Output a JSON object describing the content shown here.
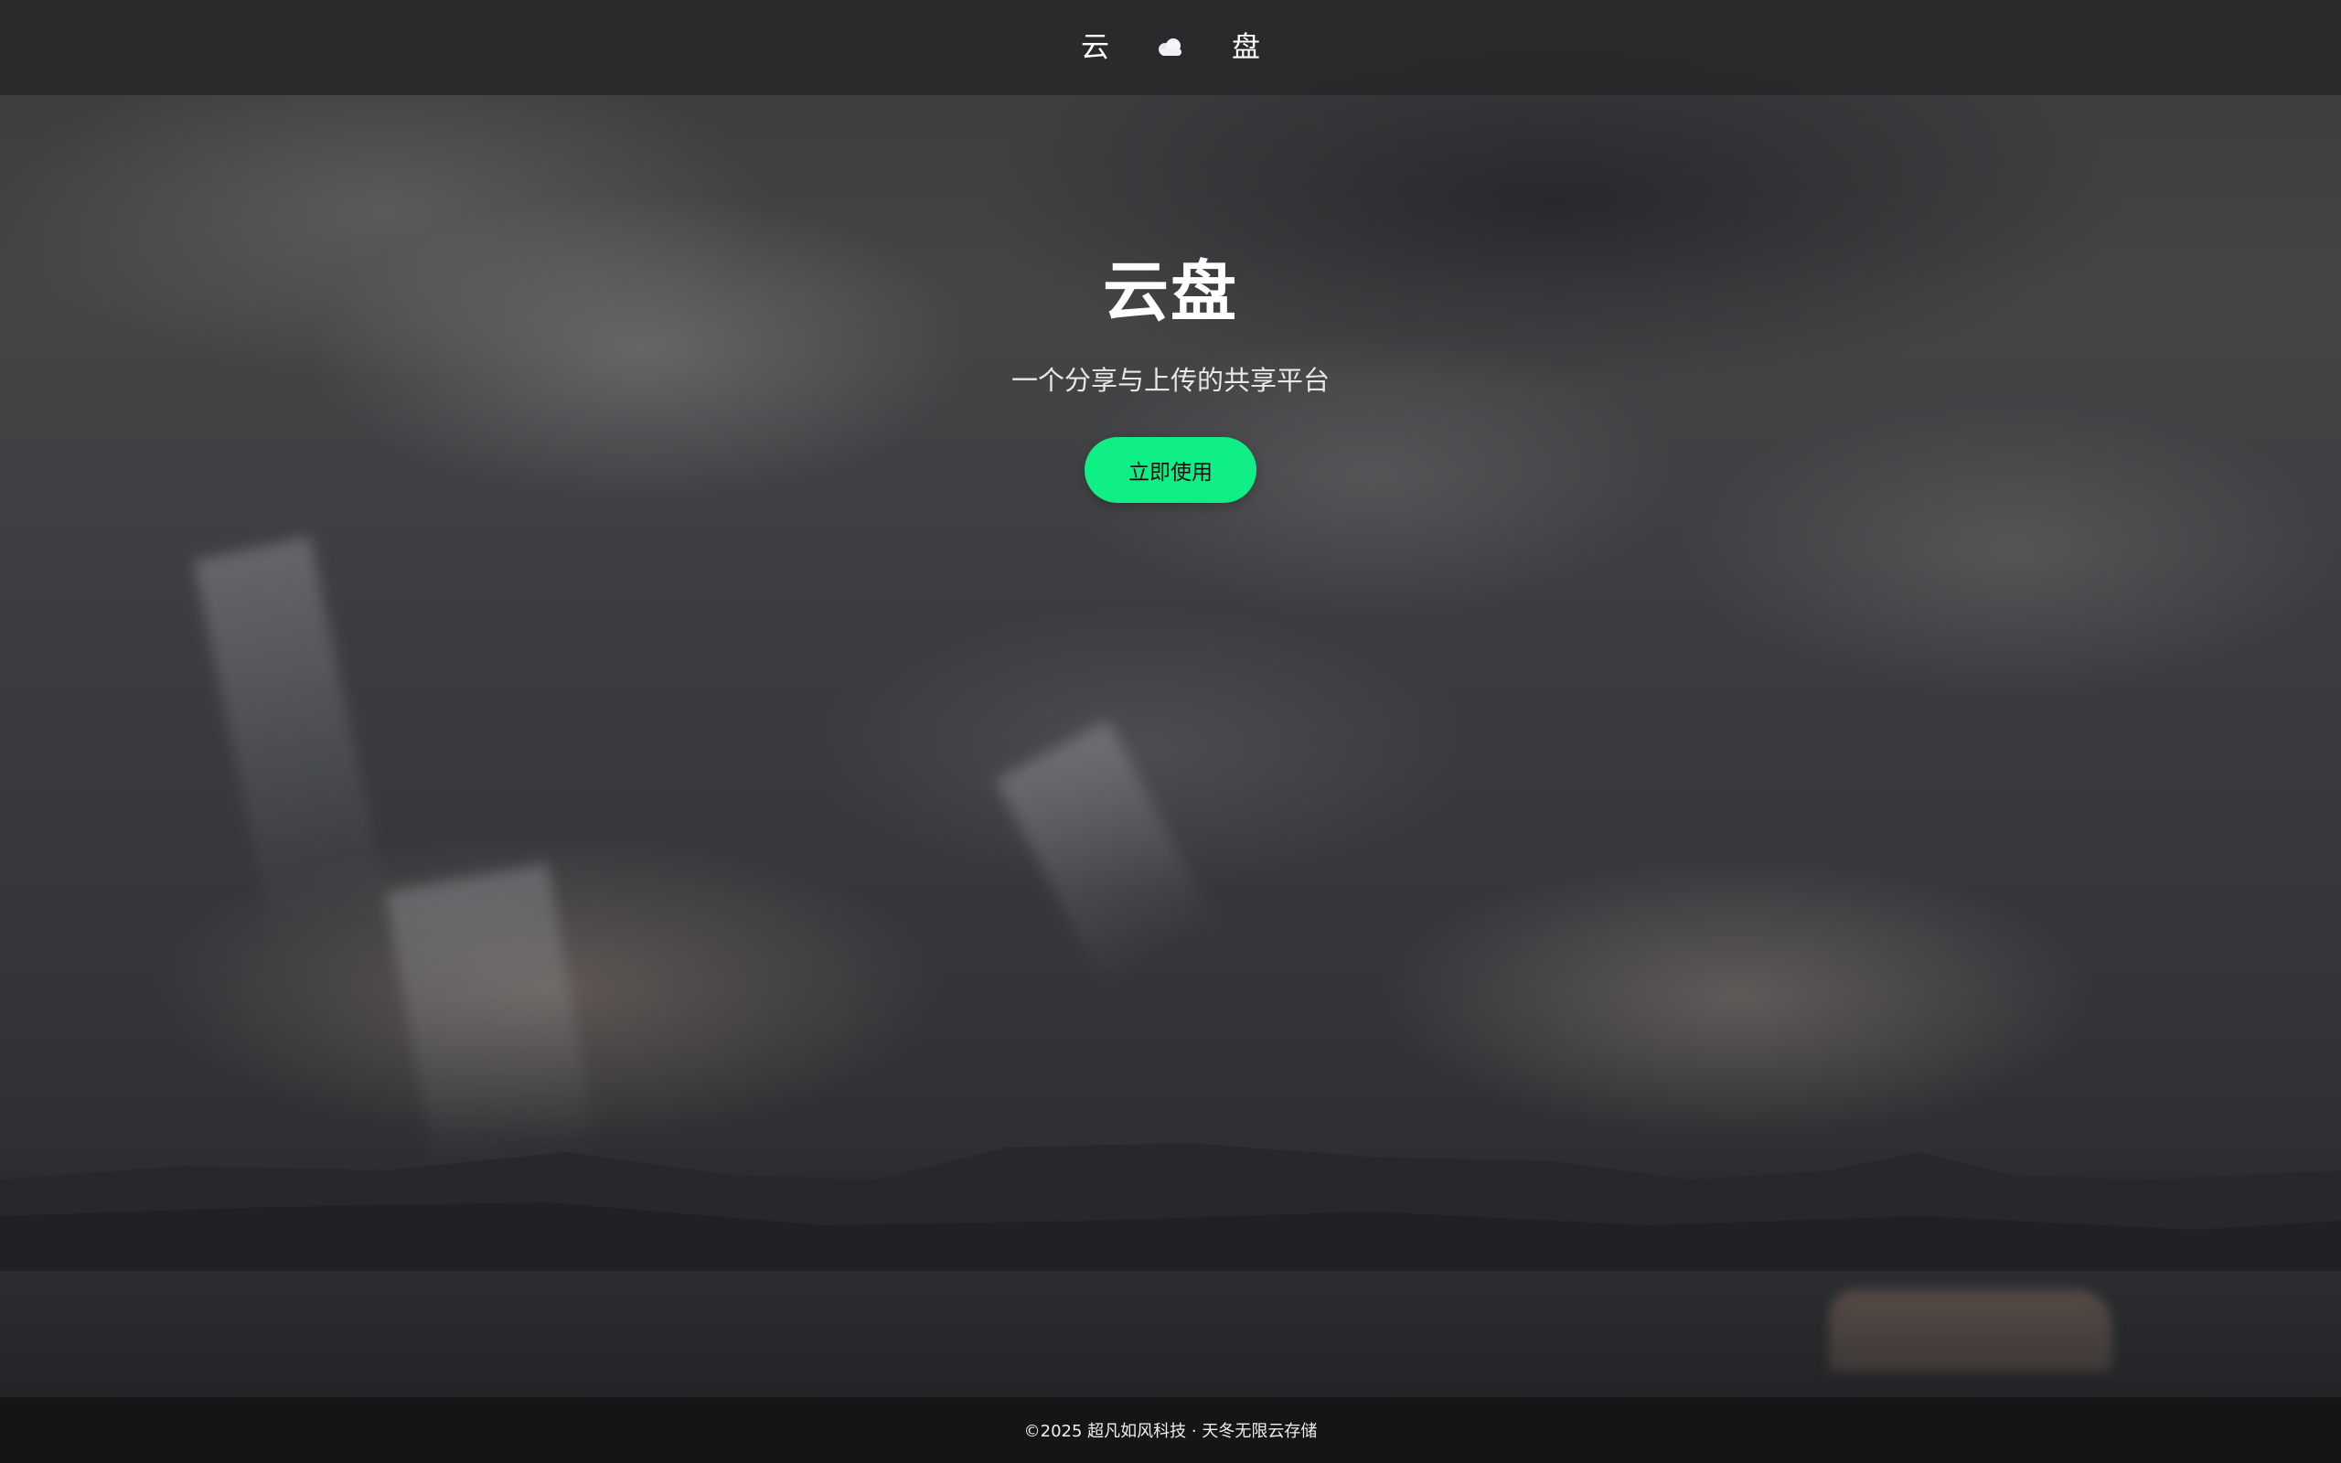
{
  "header": {
    "left_char": "云",
    "right_char": "盘",
    "logo_icon": "cloud-icon"
  },
  "hero": {
    "title": "云盘",
    "subtitle": "一个分享与上传的共享平台",
    "cta_label": "立即使用"
  },
  "footer": {
    "text": "©2025 超凡如风科技 · 天冬无限云存储"
  },
  "colors": {
    "accent": "#10ef85",
    "header_bg": "#28282a",
    "footer_bg": "#141416",
    "text": "#ffffff"
  }
}
